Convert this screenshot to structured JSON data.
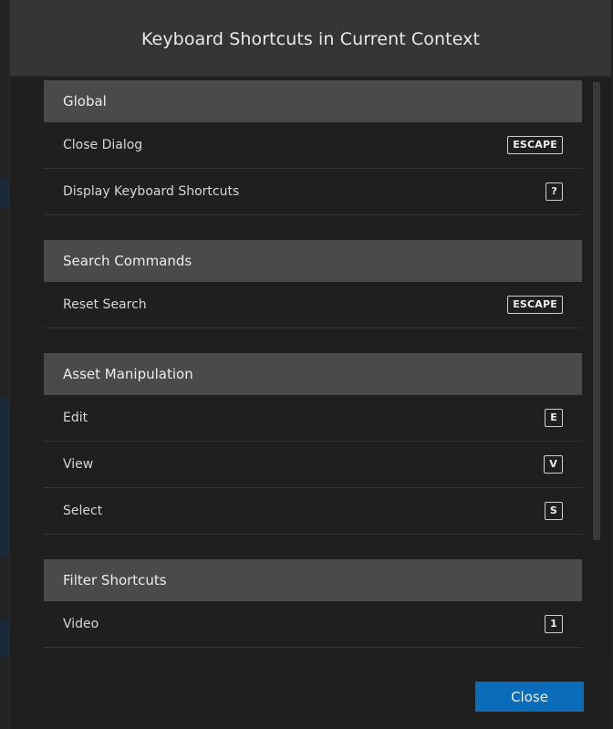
{
  "dialog": {
    "title": "Keyboard Shortcuts in Current Context",
    "close_label": "Close"
  },
  "sections": [
    {
      "title": "Global",
      "items": [
        {
          "label": "Close Dialog",
          "key": "ESCAPE"
        },
        {
          "label": "Display Keyboard Shortcuts",
          "key": "?"
        }
      ]
    },
    {
      "title": "Search Commands",
      "items": [
        {
          "label": "Reset Search",
          "key": "ESCAPE"
        }
      ]
    },
    {
      "title": "Asset Manipulation",
      "items": [
        {
          "label": "Edit",
          "key": "E"
        },
        {
          "label": "View",
          "key": "V"
        },
        {
          "label": "Select",
          "key": "S"
        }
      ]
    },
    {
      "title": "Filter Shortcuts",
      "items": [
        {
          "label": "Video",
          "key": "1"
        }
      ]
    }
  ],
  "colors": {
    "header_bg": "#353535",
    "section_bg": "#4a4a4a",
    "body_bg": "#1f1f1f",
    "primary_button": "#0b6cba"
  }
}
